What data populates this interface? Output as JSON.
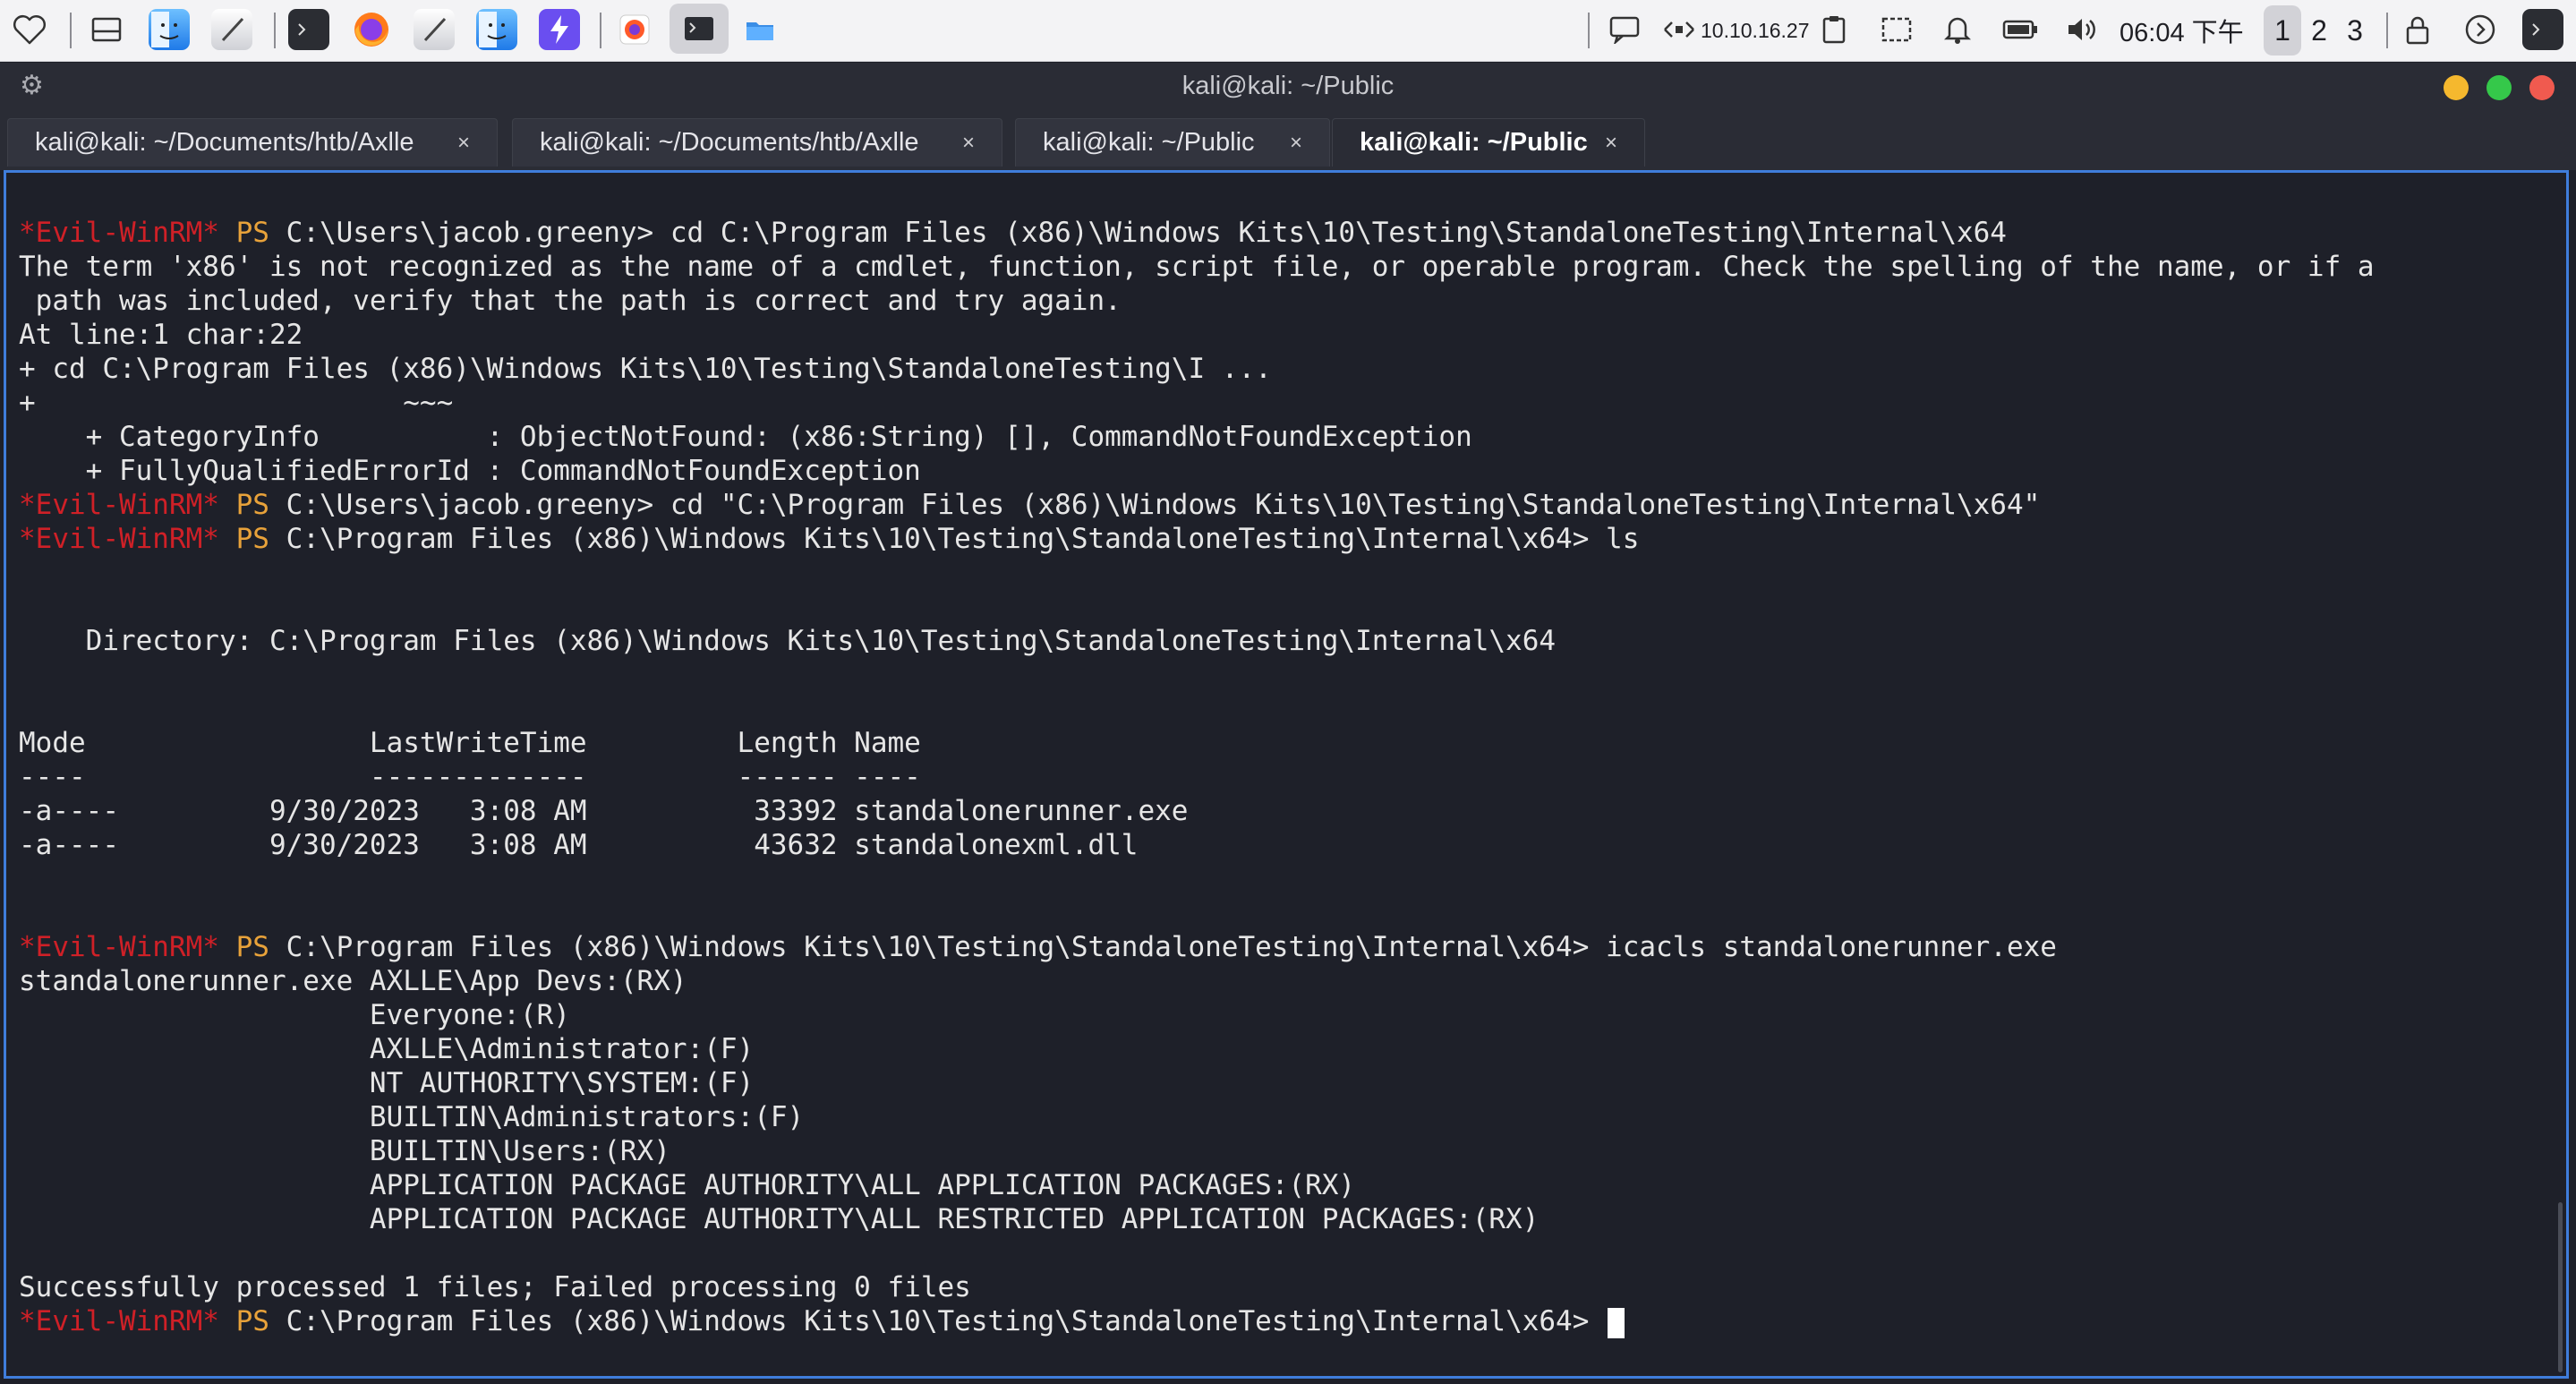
{
  "system_bar": {
    "network_ip": "10.10.16.27",
    "clock": "06:04 下午",
    "workspaces": [
      "1",
      "2",
      "3"
    ],
    "active_workspace": "1",
    "icons": [
      "heart-icon",
      "files-icon",
      "finder-icon",
      "text-editor-icon",
      "terminal-icon",
      "firefox-icon",
      "text-editor-icon",
      "finder-icon",
      "bolt-icon",
      "firefox-icon",
      "terminal-icon",
      "folder-icon"
    ]
  },
  "window": {
    "title": "kali@kali: ~/Public"
  },
  "tabs": [
    {
      "label": "kali@kali: ~/Documents/htb/Axlle",
      "close": "×"
    },
    {
      "label": "kali@kali: ~/Documents/htb/Axlle",
      "close": "×"
    },
    {
      "label": "kali@kali: ~/Public",
      "close": "×"
    },
    {
      "label": "kali@kali: ~/Public",
      "close": "×",
      "active": true
    }
  ],
  "terminal": {
    "prompt_tag": "*Evil-WinRM*",
    "prompt_ps": " PS ",
    "lines": [
      {
        "prompt": true,
        "text": "C:\\Users\\jacob.greeny> cd C:\\Program Files (x86)\\Windows Kits\\10\\Testing\\StandaloneTesting\\Internal\\x64"
      },
      {
        "text": "The term 'x86' is not recognized as the name of a cmdlet, function, script file, or operable program. Check the spelling of the name, or if a"
      },
      {
        "text": " path was included, verify that the path is correct and try again."
      },
      {
        "text": "At line:1 char:22"
      },
      {
        "text": "+ cd C:\\Program Files (x86)\\Windows Kits\\10\\Testing\\StandaloneTesting\\I ..."
      },
      {
        "text": "+                      ~~~"
      },
      {
        "text": "    + CategoryInfo          : ObjectNotFound: (x86:String) [], CommandNotFoundException"
      },
      {
        "text": "    + FullyQualifiedErrorId : CommandNotFoundException"
      },
      {
        "prompt": true,
        "text": "C:\\Users\\jacob.greeny> cd \"C:\\Program Files (x86)\\Windows Kits\\10\\Testing\\StandaloneTesting\\Internal\\x64\""
      },
      {
        "prompt": true,
        "text": "C:\\Program Files (x86)\\Windows Kits\\10\\Testing\\StandaloneTesting\\Internal\\x64> ls"
      },
      {
        "text": ""
      },
      {
        "text": ""
      },
      {
        "text": "    Directory: C:\\Program Files (x86)\\Windows Kits\\10\\Testing\\StandaloneTesting\\Internal\\x64"
      },
      {
        "text": ""
      },
      {
        "text": ""
      },
      {
        "text": "Mode                 LastWriteTime         Length Name"
      },
      {
        "text": "----                 -------------         ------ ----"
      },
      {
        "text": "-a----         9/30/2023   3:08 AM          33392 standalonerunner.exe"
      },
      {
        "text": "-a----         9/30/2023   3:08 AM          43632 standalonexml.dll"
      },
      {
        "text": ""
      },
      {
        "text": ""
      },
      {
        "prompt": true,
        "text": "C:\\Program Files (x86)\\Windows Kits\\10\\Testing\\StandaloneTesting\\Internal\\x64> icacls standalonerunner.exe"
      },
      {
        "text": "standalonerunner.exe AXLLE\\App Devs:(RX)"
      },
      {
        "text": "                     Everyone:(R)"
      },
      {
        "text": "                     AXLLE\\Administrator:(F)"
      },
      {
        "text": "                     NT AUTHORITY\\SYSTEM:(F)"
      },
      {
        "text": "                     BUILTIN\\Administrators:(F)"
      },
      {
        "text": "                     BUILTIN\\Users:(RX)"
      },
      {
        "text": "                     APPLICATION PACKAGE AUTHORITY\\ALL APPLICATION PACKAGES:(RX)"
      },
      {
        "text": "                     APPLICATION PACKAGE AUTHORITY\\ALL RESTRICTED APPLICATION PACKAGES:(RX)"
      },
      {
        "text": ""
      },
      {
        "text": "Successfully processed 1 files; Failed processing 0 files"
      },
      {
        "prompt": true,
        "cursor": true,
        "text": "C:\\Program Files (x86)\\Windows Kits\\10\\Testing\\StandaloneTesting\\Internal\\x64> "
      }
    ]
  },
  "colors": {
    "prompt_red": "#cf2027",
    "prompt_orange": "#e8a23a",
    "terminal_bg": "#1e2029",
    "focus_border": "#3f7ddb",
    "traffic_yellow": "#f5b82e",
    "traffic_green": "#35c84a",
    "traffic_red": "#f05a4f"
  }
}
